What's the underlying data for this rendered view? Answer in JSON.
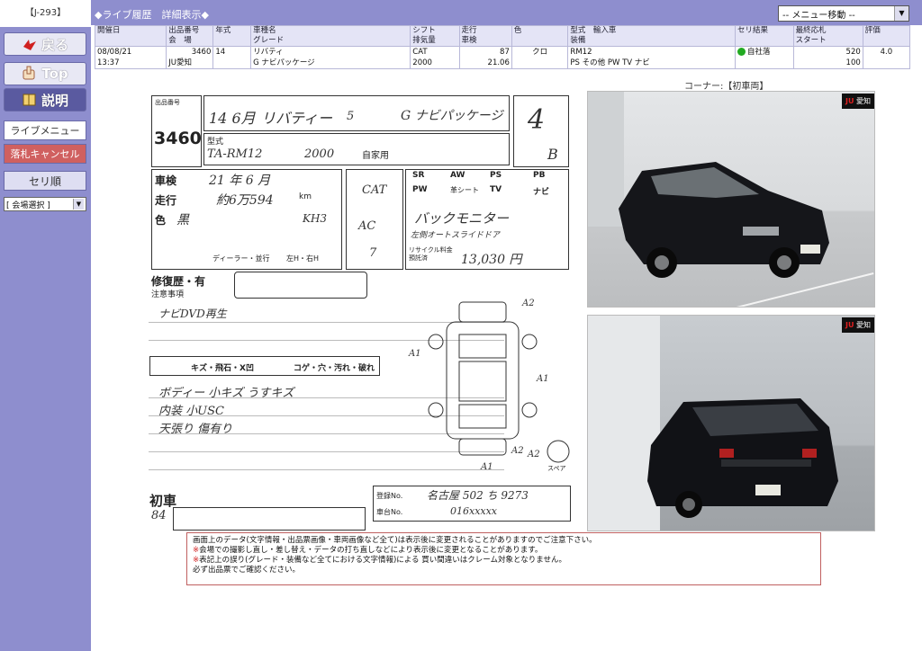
{
  "sidebar": {
    "code": "【J-293】",
    "back_label": "戻る",
    "top_label": "Top",
    "help_label": "説明",
    "live_menu_label": "ライブメニュー",
    "cancel_bid_label": "落札キャンセル",
    "auction_order_label": "セリ順",
    "venue_select_value": "[ 会場選択 ]"
  },
  "header": {
    "title": "◆ライブ履歴　詳細表示◆",
    "menu_select_value": "-- メニュー移動 --"
  },
  "info_table": {
    "headers": [
      "開催日",
      "出品番号\n会　場",
      "年式",
      "車種名\nグレード",
      "シフト\n排気量",
      "走行\n車検",
      "色",
      "型式　輸入車\n装備",
      "セリ結果",
      "最終応札\nスタート",
      "評価"
    ],
    "row": {
      "date": "08/08/21",
      "time": "13:37",
      "lot": "3460",
      "venue": "JU愛知",
      "year": "14",
      "model": "リバティ",
      "grade": "G ナビパッケージ",
      "shift": "CAT",
      "displacement": "2000",
      "mileage": "87",
      "inspection": "21.06",
      "color": "クロ",
      "type": "RM12",
      "equipment": "PS その他 PW TV ナビ",
      "result": "自社落",
      "final_bid": "520",
      "start": "100",
      "rating": "4.0"
    }
  },
  "corner_label": "コーナー:【初車両】",
  "sheet": {
    "lot_label": "出品番号",
    "lot_number": "3460",
    "year_hw": "14 6月",
    "model_hw": "リバティー",
    "doors_hw": "5",
    "grade_hw": "G ナビパッケージ",
    "score_hw": "4",
    "interior_hw": "B",
    "type_label": "型式",
    "type_hw": "TA-RM12",
    "cc_hw": "2000",
    "use_hw": "自家用",
    "inspection_label": "車検",
    "inspection_hw": "21 年 6 月",
    "mileage_label": "走行",
    "mileage_hw": "約6万594",
    "mileage_unit": "km",
    "color_label": "色",
    "color_hw": "黒",
    "color_code_hw": "KH3",
    "shift_hw": "CAT",
    "ac_hw": "AC",
    "seats_hw": "7",
    "equip_labels": [
      "SR",
      "AW",
      "PS",
      "PB",
      "PW",
      "革シート",
      "TV",
      "ナビ"
    ],
    "equip_note_hw": "バックモニター",
    "equip_note2_hw": "左側オートスライドドア",
    "recycle_label": "リサイクル料金\n預託済",
    "recycle_hw": "13,030 円",
    "dealer_label": "ディーラー・並行",
    "handle_label": "左H・右H",
    "repair_label": "修復歴・有",
    "notes_label": "注意事項",
    "notes_hw": "ナビDVD再生",
    "damage_labels": [
      "キズ・飛石・X凹",
      "コゲ・穴・汚れ・破れ"
    ],
    "remarks": [
      "ボディー 小キズ うすキズ",
      "内装 小USC",
      "天張り 傷有り"
    ],
    "first_car_label": "初車",
    "first_car_hw": "84",
    "reg_label": "登録No.",
    "reg_hw": "名古屋 502 ち 9273",
    "chassis_label": "車台No.",
    "chassis_hw": "016xxxxx",
    "diagram_marks": [
      "A2",
      "A1",
      "A1",
      "A1",
      "A2",
      "A2"
    ],
    "spare_label": "スペア"
  },
  "photos": [
    {
      "badge": "愛知",
      "brand": "JU"
    },
    {
      "badge": "愛知",
      "brand": "JU"
    }
  ],
  "notice": {
    "line1": "画面上のデータ(文字情報・出品票画像・車両画像など全て)は表示後に変更されることがありますのでご注意下さい。",
    "line2": "会場での撮影し直し・差し替え・データの打ち直しなどにより表示後に変更となることがあります。",
    "line3": "表記上の誤り(グレード・装備など全てにおける文字情報)による 買い間違いはクレーム対象となりません。",
    "line4": "必ず出品票でご確認ください。"
  }
}
